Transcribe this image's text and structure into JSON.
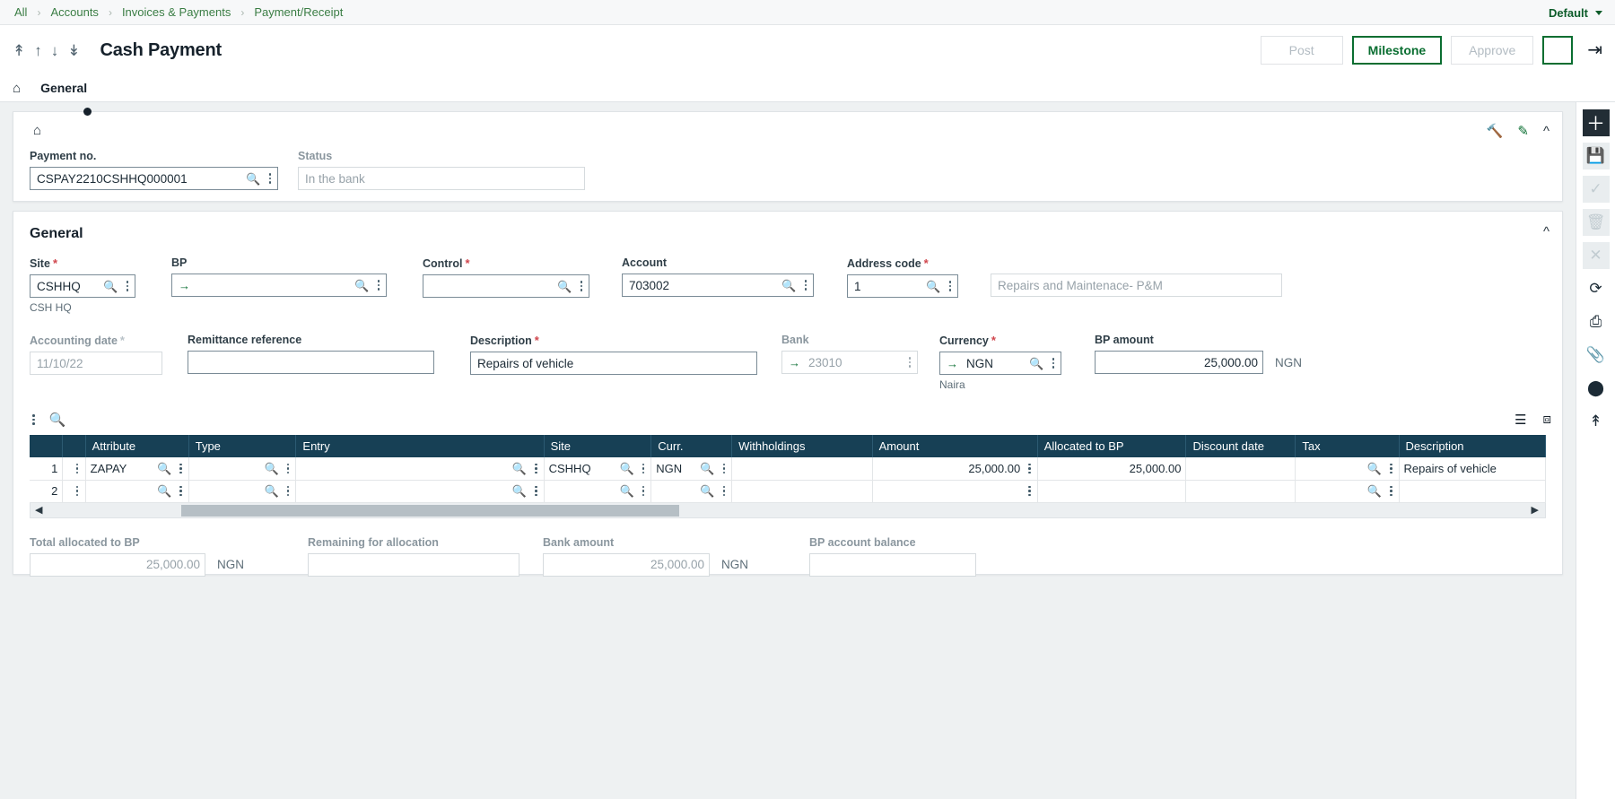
{
  "breadcrumb": {
    "items": [
      "All",
      "Accounts",
      "Invoices & Payments",
      "Payment/Receipt"
    ],
    "separator": "›",
    "right_label": "Default"
  },
  "titlebar": {
    "title": "Cash Payment",
    "nav_icons": [
      "first-arrow",
      "up-arrow",
      "down-arrow",
      "last-arrow"
    ],
    "buttons": {
      "post": "Post",
      "milestone": "Milestone",
      "approve": "Approve"
    },
    "more_icon": "kebab-menu-icon",
    "exit_icon": "exit-icon"
  },
  "tabs": {
    "home_icon": "home-icon",
    "items": [
      {
        "label": "General",
        "active": true
      }
    ]
  },
  "header_card": {
    "home_icon": "home-icon",
    "icons": [
      "wrench-icon",
      "pencil-icon",
      "chevron-up-icon"
    ],
    "payment_no": {
      "label": "Payment no.",
      "value": "CSPAY2210CSHHQ000001"
    },
    "status": {
      "label": "Status",
      "value": "In the bank"
    }
  },
  "general": {
    "section_title": "General",
    "collapse_icon": "chevron-up-icon",
    "row1": {
      "site": {
        "label": "Site",
        "required": true,
        "value": "CSHHQ",
        "helper": "CSH HQ"
      },
      "bp": {
        "label": "BP",
        "required": false,
        "value": "",
        "link": true
      },
      "control": {
        "label": "Control",
        "required": true,
        "value": ""
      },
      "account": {
        "label": "Account",
        "required": false,
        "value": "703002"
      },
      "address_code": {
        "label": "Address code",
        "required": true,
        "value": "1"
      },
      "account_desc": {
        "value": "Repairs and Maintenace- P&M"
      }
    },
    "row2": {
      "accounting_date": {
        "label": "Accounting date",
        "required": true,
        "value": "11/10/22",
        "readonly": true
      },
      "remittance_reference": {
        "label": "Remittance reference",
        "value": ""
      },
      "description": {
        "label": "Description",
        "required": true,
        "value": "Repairs of vehicle"
      },
      "bank": {
        "label": "Bank",
        "value": "23010",
        "readonly": true,
        "link": true
      },
      "currency": {
        "label": "Currency",
        "required": true,
        "value": "NGN",
        "helper": "Naira",
        "link": true
      },
      "bp_amount": {
        "label": "BP amount",
        "value": "25,000.00",
        "unit": "NGN"
      }
    }
  },
  "grid": {
    "tools": [
      "kebab-menu-icon",
      "search-icon"
    ],
    "tools_right": [
      "layers-icon",
      "expand-icon"
    ],
    "columns": [
      "",
      "",
      "Attribute",
      "Type",
      "Entry",
      "Site",
      "Curr.",
      "Withholdings",
      "Amount",
      "Allocated to BP",
      "Discount date",
      "Tax",
      "Description"
    ],
    "rows": [
      {
        "num": "1",
        "attribute": "ZAPAY",
        "type": "",
        "entry": "",
        "site": "CSHHQ",
        "curr": "NGN",
        "withholdings": "",
        "amount": "25,000.00",
        "allocated_to_bp": "25,000.00",
        "discount_date": "",
        "tax": "",
        "description": "Repairs of vehicle"
      },
      {
        "num": "2",
        "attribute": "",
        "type": "",
        "entry": "",
        "site": "",
        "curr": "",
        "withholdings": "",
        "amount": "",
        "allocated_to_bp": "",
        "discount_date": "",
        "tax": "",
        "description": ""
      }
    ]
  },
  "totals": {
    "total_allocated": {
      "label": "Total allocated to BP",
      "value": "25,000.00",
      "unit": "NGN"
    },
    "remaining": {
      "label": "Remaining for allocation",
      "value": ""
    },
    "bank_amount": {
      "label": "Bank amount",
      "value": "25,000.00",
      "unit": "NGN"
    },
    "bp_account_balance": {
      "label": "BP account balance",
      "value": ""
    }
  },
  "right_rail": {
    "items": [
      {
        "icon": "add-icon",
        "glyph": "＋",
        "state": "active"
      },
      {
        "icon": "save-icon",
        "glyph": "💾",
        "state": "disabled"
      },
      {
        "icon": "check-icon",
        "glyph": "✓",
        "state": "disabled"
      },
      {
        "icon": "trash-icon",
        "glyph": "🗑",
        "state": "disabled"
      },
      {
        "icon": "close-icon",
        "glyph": "✕",
        "state": "disabled"
      },
      {
        "icon": "refresh-icon",
        "glyph": "⟳",
        "state": "normal"
      },
      {
        "icon": "print-icon",
        "glyph": "⎙",
        "state": "normal"
      },
      {
        "icon": "attachment-icon",
        "glyph": "📎",
        "state": "normal"
      },
      {
        "icon": "comment-icon",
        "glyph": "⬤",
        "state": "normal"
      },
      {
        "icon": "share-icon",
        "glyph": "⇧",
        "state": "normal"
      }
    ]
  }
}
